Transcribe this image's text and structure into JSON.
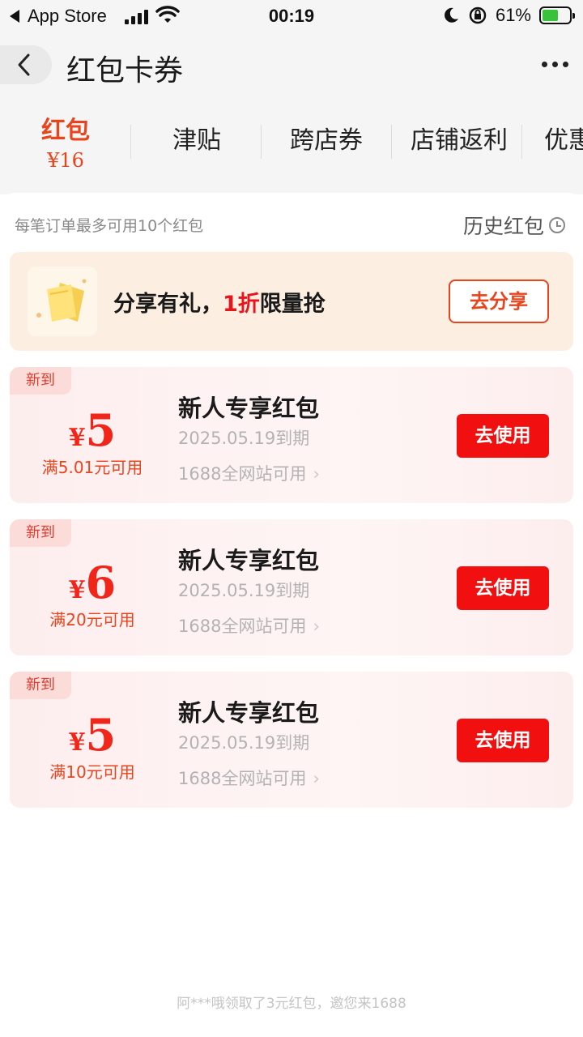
{
  "status_bar": {
    "back_app": "App Store",
    "time": "00:19",
    "battery_pct": "61%"
  },
  "nav": {
    "title": "红包卡券",
    "more_icon": "more-dots-icon",
    "back_icon": "chevron-left-icon"
  },
  "tabs": [
    {
      "label": "红包",
      "amount": "¥16",
      "active": true
    },
    {
      "label": "津贴"
    },
    {
      "label": "跨店券"
    },
    {
      "label": "店铺返利"
    },
    {
      "label": "优惠"
    }
  ],
  "notice": "每笔订单最多可用10个红包",
  "history_label": "历史红包",
  "share_banner": {
    "text_pre": "分享有礼，",
    "text_hl": "1折",
    "text_post": "限量抢",
    "button": "去分享"
  },
  "coupons": [
    {
      "badge": "新到",
      "currency": "¥",
      "value": "5",
      "condition": "满5.01元可用",
      "name": "新人专享红包",
      "expiry": "2025.05.19到期",
      "scope": "1688全网站可用",
      "button": "去使用"
    },
    {
      "badge": "新到",
      "currency": "¥",
      "value": "6",
      "condition": "满20元可用",
      "name": "新人专享红包",
      "expiry": "2025.05.19到期",
      "scope": "1688全网站可用",
      "button": "去使用"
    },
    {
      "badge": "新到",
      "currency": "¥",
      "value": "5",
      "condition": "满10元可用",
      "name": "新人专享红包",
      "expiry": "2025.05.19到期",
      "scope": "1688全网站可用",
      "button": "去使用"
    }
  ],
  "ticker": "阿***哦领取了3元红包，邀您来1688",
  "colors": {
    "accent": "#e7451e",
    "button_red": "#f20f0f",
    "share_bg": "#fdeee2",
    "coupon_bg": "#fdeeee"
  }
}
